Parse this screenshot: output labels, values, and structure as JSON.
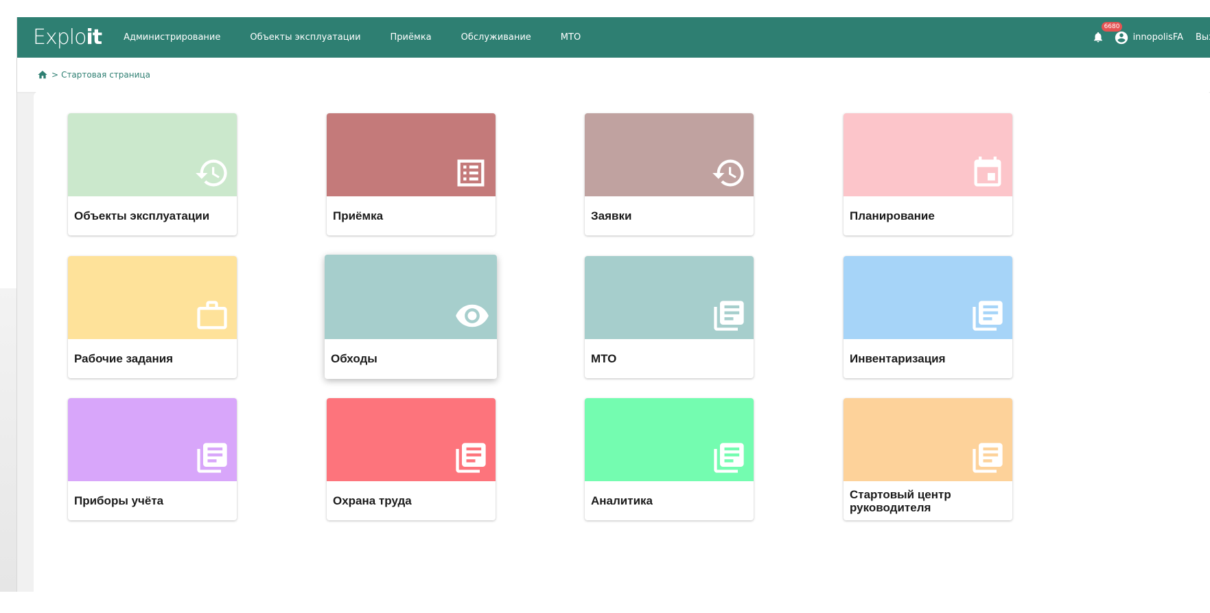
{
  "app": {
    "logo_light": "Explo",
    "logo_bold": "it"
  },
  "nav": {
    "items": [
      "Администрирование",
      "Объекты эксплуатации",
      "Приёмка",
      "Обслуживание",
      "МТО"
    ]
  },
  "header": {
    "notifications_count": "6680",
    "username": "innopolisFA",
    "logout_label": "Выход"
  },
  "breadcrumb": {
    "separator": ">",
    "current": "Стартовая страница"
  },
  "tiles": [
    {
      "label": "Объекты эксплуатации",
      "color": "#cbe8cc",
      "icon": "history-icon"
    },
    {
      "label": "Приёмка",
      "color": "#c47a7a",
      "icon": "list-icon"
    },
    {
      "label": "Заявки",
      "color": "#c0a2a0",
      "icon": "history-icon"
    },
    {
      "label": "Планирование",
      "color": "#fcc5ca",
      "icon": "calendar-icon"
    },
    {
      "label": "Рабочие задания",
      "color": "#fee29a",
      "icon": "briefcase-icon"
    },
    {
      "label": "Обходы",
      "color": "#a6cecc",
      "icon": "eye-icon"
    },
    {
      "label": "МТО",
      "color": "#a6cecc",
      "icon": "library-books-icon"
    },
    {
      "label": "Инвентаризация",
      "color": "#a6d4f8",
      "icon": "library-books-icon"
    },
    {
      "label": "Приборы учёта",
      "color": "#d8a6fa",
      "icon": "library-books-icon"
    },
    {
      "label": "Охрана труда",
      "color": "#fd747c",
      "icon": "library-books-icon"
    },
    {
      "label": "Аналитика",
      "color": "#74fcb0",
      "icon": "library-books-icon"
    },
    {
      "label": "Стартовый центр руководителя",
      "color": "#fdd29a",
      "icon": "library-books-icon"
    }
  ]
}
